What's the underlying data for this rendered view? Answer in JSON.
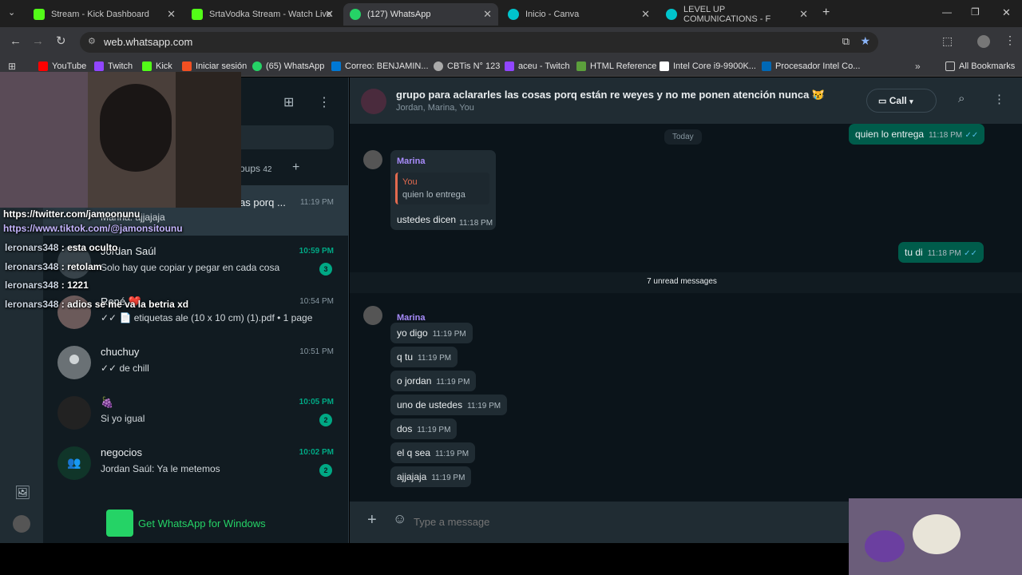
{
  "browser": {
    "tabs": [
      {
        "label": "Stream - Kick Dashboard",
        "color": "#53fc18"
      },
      {
        "label": "SrtaVodka Stream - Watch Live",
        "color": "#53fc18"
      },
      {
        "label": "(127) WhatsApp",
        "color": "#25d366"
      },
      {
        "label": "Inicio - Canva",
        "color": "#00c4cc"
      },
      {
        "label": "LEVEL UP COMUNICATIONS - F",
        "color": "#00c4cc"
      }
    ],
    "url": "web.whatsapp.com",
    "bookmarks": [
      "YouTube",
      "Twitch",
      "Kick",
      "Iniciar sesión",
      "(65) WhatsApp",
      "Correo: BENJAMIN...",
      "CBTis N° 123",
      "aceu - Twitch",
      "HTML Reference",
      "Intel Core i9-9900K...",
      "Procesador Intel Co...",
      "All Bookmarks"
    ]
  },
  "sidebar": {
    "groups_count": "42",
    "groups_label": "oups",
    "chats": [
      {
        "name": "",
        "preview": "Marina: ajjajaja",
        "title_tail": "as porq ...",
        "time": "11:19 PM",
        "unread": false,
        "badge": ""
      },
      {
        "name": "Jordan Saúl",
        "preview": "Solo hay que copiar y pegar en cada cosa",
        "time": "10:59 PM",
        "unread": true,
        "badge": "3"
      },
      {
        "name": "René ❤️",
        "preview": "✓✓ 📄 etiquetas ale (10 x 10 cm) (1).pdf • 1 page",
        "time": "10:54 PM",
        "unread": false,
        "badge": ""
      },
      {
        "name": "chuchuy",
        "preview": "✓✓ de chill",
        "time": "10:51 PM",
        "unread": false,
        "badge": ""
      },
      {
        "name": "🍇",
        "preview": "Si yo igual",
        "time": "10:05 PM",
        "unread": true,
        "badge": "2"
      },
      {
        "name": "negocios",
        "preview": "Jordan Saúl: Ya le metemos",
        "time": "10:02 PM",
        "unread": true,
        "badge": "2"
      }
    ],
    "get_app": "Get WhatsApp for Windows"
  },
  "chat": {
    "title": "grupo para aclararles las cosas porq están re weyes y no me ponen atención nunca 😿",
    "members": "Jordan, Marina, You",
    "call_label": "Call",
    "today": "Today",
    "unread_divider": "7 unread messages",
    "input_placeholder": "Type a message",
    "messages": {
      "m0": {
        "text": "quien lo entrega",
        "time": "11:18 PM"
      },
      "marina1": "Marina",
      "quote_author": "You",
      "quote_text": "quien lo entrega",
      "m1": {
        "text": "ustedes dicen",
        "time": "11:18 PM"
      },
      "m2": {
        "text": "tu di",
        "time": "11:18 PM"
      },
      "marina2": "Marina",
      "m3": {
        "text": "yo digo",
        "time": "11:19 PM"
      },
      "m4": {
        "text": "q tu",
        "time": "11:19 PM"
      },
      "m5": {
        "text": "o jordan",
        "time": "11:19 PM"
      },
      "m6": {
        "text": "uno de ustedes",
        "time": "11:19 PM"
      },
      "m7": {
        "text": "dos",
        "time": "11:19 PM"
      },
      "m8": {
        "text": "el q sea",
        "time": "11:19 PM"
      },
      "m9": {
        "text": "ajjajaja",
        "time": "11:19 PM"
      }
    }
  },
  "stream_overlay": {
    "twitter": "https://twitter.com/jamoonunu",
    "tiktok": "https://www.tiktok.com/@jamonsitounu",
    "chat_lines": [
      {
        "user": "leronars348",
        "msg": ": esta oculto"
      },
      {
        "user": "leronars348",
        "msg": ": retolam"
      },
      {
        "user": "leronars348",
        "msg": ": 1221"
      },
      {
        "user": "leronars348",
        "msg": ": adios se me va la betria xd"
      }
    ]
  }
}
